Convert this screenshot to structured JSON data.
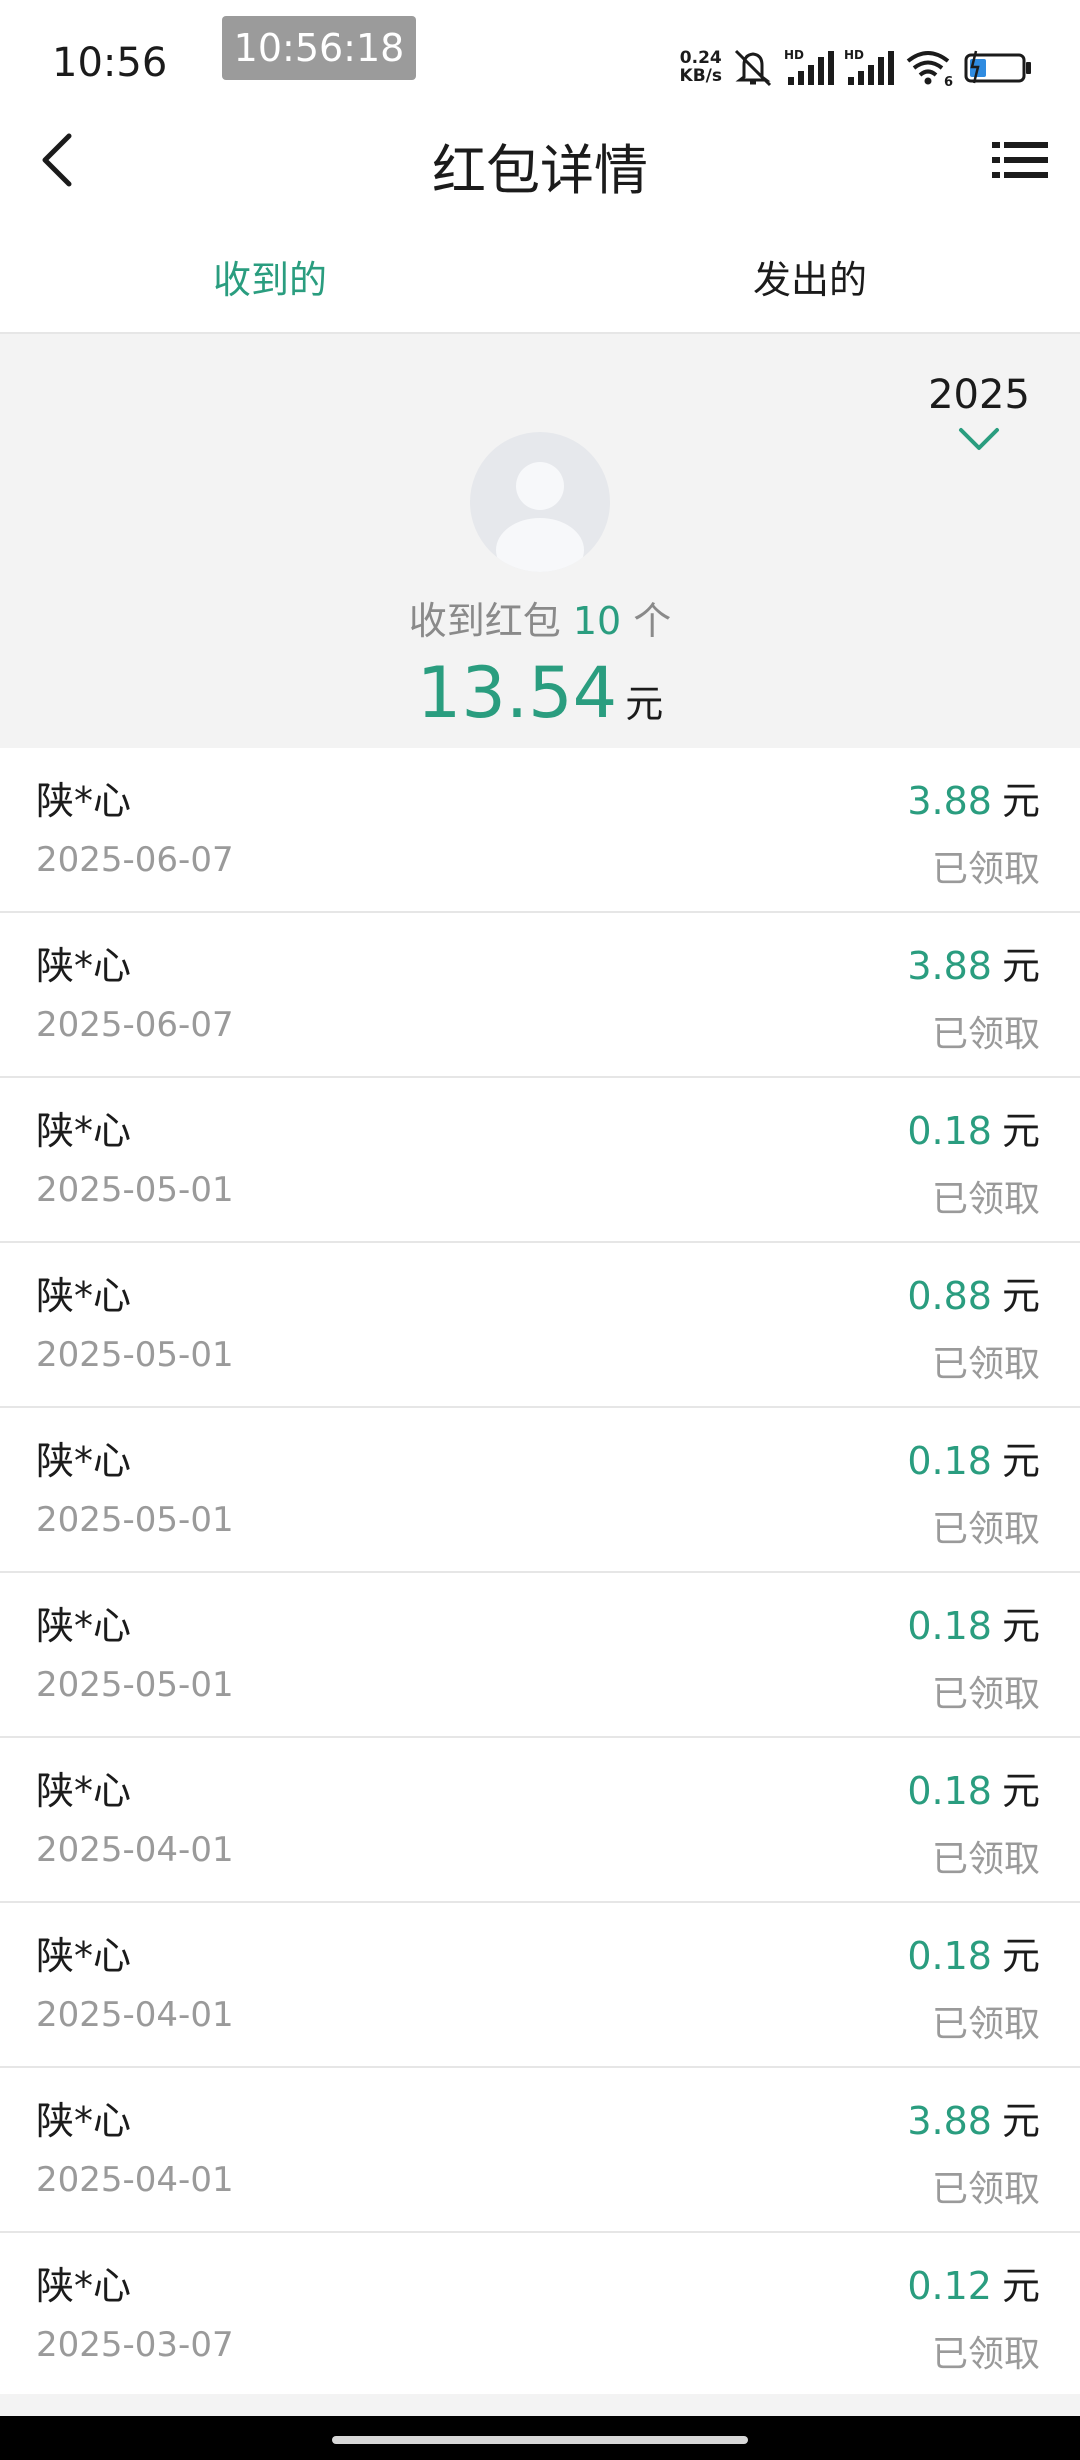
{
  "status_bar": {
    "time": "10:56",
    "clock_overlay": "10:56:18",
    "net_speed_value": "0.24",
    "net_speed_unit": "KB/s",
    "icons": [
      "mute-icon",
      "signal-hd-icon",
      "signal-hd-icon",
      "wifi-icon",
      "battery-charging-icon"
    ],
    "hd_label": "HD",
    "wifi_label": "6"
  },
  "header": {
    "title": "红包详情",
    "back_icon": "back-arrow-icon",
    "menu_icon": "list-menu-icon"
  },
  "tabs": [
    {
      "label": "收到的",
      "active": true
    },
    {
      "label": "发出的",
      "active": false
    }
  ],
  "summary": {
    "year": "2025",
    "count_prefix": "收到红包",
    "count": "10",
    "count_suffix": "个",
    "total": "13.54",
    "unit": "元"
  },
  "records": [
    {
      "name": "陕*心",
      "date": "2025-06-07",
      "amount": "3.88",
      "unit": "元",
      "status": "已领取"
    },
    {
      "name": "陕*心",
      "date": "2025-06-07",
      "amount": "3.88",
      "unit": "元",
      "status": "已领取"
    },
    {
      "name": "陕*心",
      "date": "2025-05-01",
      "amount": "0.18",
      "unit": "元",
      "status": "已领取"
    },
    {
      "name": "陕*心",
      "date": "2025-05-01",
      "amount": "0.88",
      "unit": "元",
      "status": "已领取"
    },
    {
      "name": "陕*心",
      "date": "2025-05-01",
      "amount": "0.18",
      "unit": "元",
      "status": "已领取"
    },
    {
      "name": "陕*心",
      "date": "2025-05-01",
      "amount": "0.18",
      "unit": "元",
      "status": "已领取"
    },
    {
      "name": "陕*心",
      "date": "2025-04-01",
      "amount": "0.18",
      "unit": "元",
      "status": "已领取"
    },
    {
      "name": "陕*心",
      "date": "2025-04-01",
      "amount": "0.18",
      "unit": "元",
      "status": "已领取"
    },
    {
      "name": "陕*心",
      "date": "2025-04-01",
      "amount": "3.88",
      "unit": "元",
      "status": "已领取"
    },
    {
      "name": "陕*心",
      "date": "2025-03-07",
      "amount": "0.12",
      "unit": "元",
      "status": "已领取"
    }
  ],
  "colors": {
    "accent": "#2a9d7f",
    "summary_bg": "#f3f3f3",
    "muted_text": "#9a9a9a",
    "divider": "#e6e6e6"
  }
}
